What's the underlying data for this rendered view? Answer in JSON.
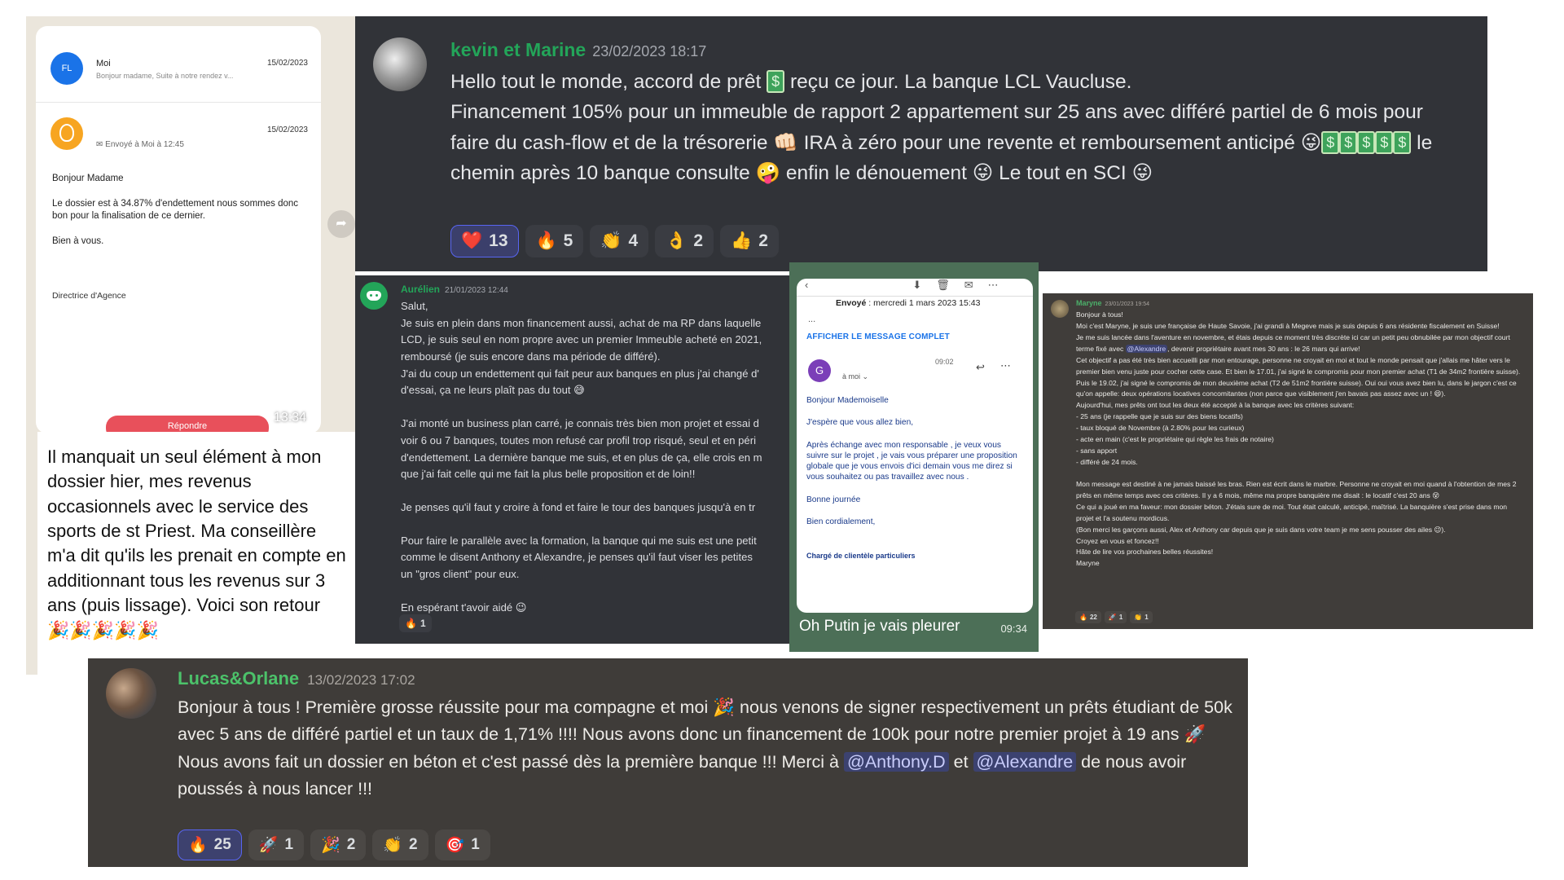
{
  "whatsapp": {
    "mail_list": {
      "first": {
        "avatar_initials": "FL",
        "sender": "Moi",
        "date": "15/02/2023",
        "snippet": "Bonjour madame, Suite à notre rendez v..."
      },
      "second": {
        "date": "15/02/2023",
        "sent_label": "Envoyé à Moi à 12:45"
      }
    },
    "email_body": {
      "greeting": "Bonjour Madame",
      "paragraph": "Le dossier est à 34.87% d'endettement nous sommes donc bon pour la finalisation de ce dernier.",
      "closing": "Bien à vous.",
      "signature": "Directrice d'Agence"
    },
    "reply_button": "Répondre",
    "image_time": "13:34",
    "message_text": "Il manquait un seul élément à mon dossier hier, mes revenus occasionnels avec le service des sports de st Priest. Ma conseillère m'a dit qu'ils les prenait en compte en additionnant tous les revenus sur 3 ans (puis lissage). Voici son retour 🎉🎉🎉🎉🎉"
  },
  "kevin_marine": {
    "author": "kevin et Marine",
    "timestamp": "23/02/2023 18:17",
    "line1": "Hello tout le monde, accord de prêt",
    "line1_end": "reçu ce jour. La banque LCL Vaucluse.",
    "line2": "Financement  105% pour un immeuble de rapport 2 appartement sur 25 ans avec différé partiel de 6 mois pour faire du cash-flow et de la trésorerie",
    "line2_end": "IRA à zéro pour une revente et remboursement anticipé",
    "line3": "le chemin après 10 banque consulte",
    "line3_b": "enfin le dénouement",
    "line3_c": "Le tout en SCI",
    "reactions": [
      {
        "emoji": "❤️",
        "count": "13",
        "me": true
      },
      {
        "emoji": "🔥",
        "count": "5"
      },
      {
        "emoji": "👏",
        "count": "4"
      },
      {
        "emoji": "👌",
        "count": "2"
      },
      {
        "emoji": "👍",
        "count": "2"
      }
    ]
  },
  "aurelien": {
    "author": "Aurélien",
    "timestamp": "21/01/2023 12:44",
    "p1": "Salut,\nJe suis en plein dans mon financement aussi, achat de ma RP dans laquelle\nLCD, je suis seul en nom propre avec un premier Immeuble acheté en 2021,\nremboursé (je suis encore dans ma période de différé).\nJ'ai du coup un endettement qui fait peur aux banques en plus j'ai changé d'\nd'essai, ça ne leurs plaît pas du tout 😅",
    "p2": "J'ai monté un business plan carré, je connais très bien mon projet et essai d\nvoir 6 ou 7 banques, toutes mon refusé car profil trop risqué, seul et en péri\nd'endettement. La dernière banque me suis, et en plus de ça, elle crois en m\nque j'ai fait celle qui me fait la plus belle proposition et de loin!!",
    "p3": "Je penses qu'il faut y croire à fond et faire le tour des banques jusqu'à en tr",
    "p4": "Pour faire le parallèle avec la formation, la banque qui me suis est une petit\ncomme le disent Anthony et Alexandre, je penses qu'il faut viser les petites\nun \"gros client\" pour eux.",
    "p5": "En espérant t'avoir aidé 😉",
    "reactions": [
      {
        "emoji": "🔥",
        "count": "1"
      }
    ]
  },
  "phone": {
    "sent_label": "Envoyé",
    "sent_date": ": mercredi 1 mars 2023 15:43",
    "ellipsis": "...",
    "show_full": "AFFICHER LE MESSAGE COMPLET",
    "avatar_letter": "G",
    "to_me": "à moi ⌄",
    "time": "09:02",
    "greeting": "Bonjour Mademoiselle",
    "hope": "J'espère que vous allez bien,",
    "body": "Après échange avec mon responsable , je veux vous suivre sur le projet , je vais vous préparer une proposition globale que je vous envois d'ici demain vous me direz si vous souhaitez ou pas travaillez avec nous .",
    "bye": "Bonne journée",
    "regards": "Bien cordialement,",
    "footer": "Chargé de clientèle particuliers",
    "caption": "Oh Putin je vais pleurer",
    "caption_time": "09:34"
  },
  "maryne": {
    "author": "Maryne",
    "timestamp": "23/01/2023 19:54",
    "p1a": "Bonjour à tous!",
    "p1b": "Moi c'est Maryne, je suis une française de Haute Savoie, j'ai grandi à Megeve mais je suis depuis 6 ans résidente fiscalement en Suisse!",
    "p1c": "Je me suis lancée dans l'aventure en novembre, et étais depuis ce moment très discrète ici car un petit peu obnubilée par mon objectif court terme fixé avec",
    "mention1": "@Alexandre",
    "p1d": ", devenir propriétaire avant mes 30 ans : le 26 mars qui arrive!",
    "p1e": "Cet objectif a pas été très bien accueilli par mon entourage, personne ne croyait en moi et tout le monde pensait que j'allais me hâter vers le premier bien venu juste pour cocher cette case. Et bien le 17.01, j'ai signé le compromis pour mon premier achat (T1 de 34m2 frontière suisse). Puis le 19.02, j'ai signé le compromis de mon deuxième achat (T2 de 51m2 frontière suisse). Oui oui vous avez bien lu, dans le jargon c'est ce qu'on appelle: deux opérations locatives concomitantes (non parce que visiblement j'en bavais pas assez avec un ! 😄).",
    "p1f": "Aujourd'hui, mes prêts ont tout les deux été accepté à la banque avec les critères suivant:",
    "criteria": [
      "- 25 ans (je rappelle que je suis sur des biens locatifs)",
      "- taux bloqué de Novembre (à 2.80% pour les curieux)",
      "- acte en main (c'est le propriétaire qui règle les frais de notaire)",
      "- sans apport",
      "- différé de 24 mois."
    ],
    "p2a": "Mon message est destiné à ne jamais baissé les bras. Rien est écrit dans le marbre. Personne ne croyait en moi quand à l'obtention de mes 2 prêts en même temps avec ces critères. Il y a 6 mois, même ma propre banquière me disait : le locatif c'est 20 ans 😵",
    "p2b": "Ce qui a joué en ma faveur: mon dossier béton. J'étais sure de moi. Tout était calculé, anticipé, maîtrisé. La banquière s'est prise dans mon projet et l'a soutenu mordicus.",
    "p2c": "(Bon merci les garçons aussi, Alex et Anthony car depuis que je suis dans votre team je me sens pousser des ailes 😉).",
    "p2d": "Croyez en vous et foncez!!",
    "p2e": "Hâte de lire vos prochaines belles réussites!",
    "p2f": "Maryne",
    "reactions": [
      {
        "emoji": "🔥",
        "count": "22"
      },
      {
        "emoji": "🚀",
        "count": "1"
      },
      {
        "emoji": "👏",
        "count": "1"
      }
    ]
  },
  "lucas_orlane": {
    "author": "Lucas&Orlane",
    "timestamp": "13/02/2023 17:02",
    "l1a": "Bonjour à tous ! Première grosse réussite pour ma compagne et moi",
    "l1b": "nous venons de signer respectivement un prêts étudiant de 50k avec 5 ans de différé partiel et un taux de 1,71% !!!! Nous avons donc un financement de 100k pour notre premier projet à 19 ans",
    "l2a": "Nous avons fait un dossier en béton et c'est passé dès la première banque !!! Merci à",
    "mention1": "@Anthony.D",
    "l2b": "et",
    "mention2": "@Alexandre",
    "l2c": "de nous avoir poussés à nous lancer !!!",
    "reactions": [
      {
        "emoji": "🔥",
        "count": "25",
        "me": true
      },
      {
        "emoji": "🚀",
        "count": "1"
      },
      {
        "emoji": "🎉",
        "count": "2"
      },
      {
        "emoji": "👏",
        "count": "2"
      },
      {
        "emoji": "🎯",
        "count": "1"
      }
    ]
  }
}
